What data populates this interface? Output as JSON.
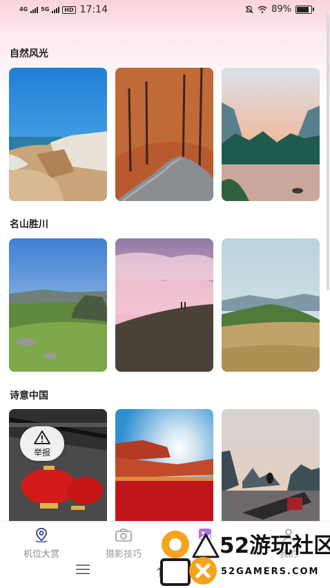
{
  "status_bar": {
    "net1": "4G",
    "net2": "5G",
    "hd": "HD",
    "time": "17:14",
    "battery": "89%"
  },
  "sections": [
    {
      "title": "自然风光"
    },
    {
      "title": "名山胜川"
    },
    {
      "title": "诗意中国"
    }
  ],
  "report": {
    "label": "举报",
    "icon": "warning-triangle-icon"
  },
  "bottom_nav": [
    {
      "label": "机位大赏",
      "icon": "location-pin-icon",
      "active": true
    },
    {
      "label": "摄影技巧",
      "icon": "camera-icon",
      "active": false
    },
    {
      "label": "美图",
      "icon": "image-icon",
      "active": false
    },
    {
      "label": "我的",
      "icon": "person-icon",
      "active": false
    }
  ],
  "watermark": {
    "brand": "52游玩社区",
    "domain": "52GAMERS.COM"
  }
}
